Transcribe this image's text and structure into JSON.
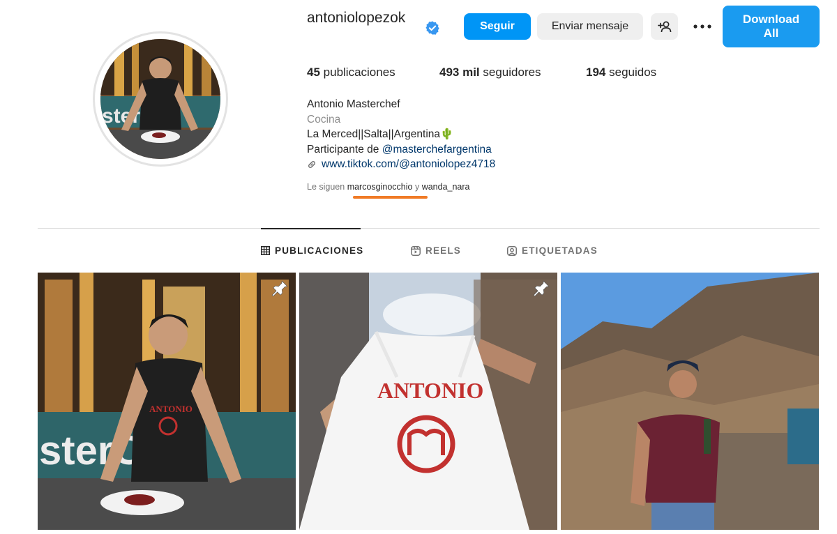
{
  "profile": {
    "username": "antoniolopezok",
    "verified": true,
    "display_name": "Antonio Masterchef",
    "category": "Cocina",
    "bio_line1": "La Merced||Salta||Argentina🌵",
    "bio_line2_prefix": "Participante de ",
    "bio_line2_mention": "@masterchefargentina",
    "link": "www.tiktok.com/@antoniolopez4718"
  },
  "actions": {
    "follow": "Seguir",
    "message": "Enviar mensaje",
    "add_user_icon": "add-user-icon",
    "more_icon": "more-options-icon",
    "download": "Download All"
  },
  "stats": {
    "posts_count": "45",
    "posts_label": "publicaciones",
    "followers_count": "493 mil",
    "followers_label": "seguidores",
    "following_count": "194",
    "following_label": "seguidos"
  },
  "followed_by": {
    "prefix": "Le siguen ",
    "account1": "marcosginocchio",
    "conjunction": " y ",
    "account2": "wanda_nara"
  },
  "tabs": [
    {
      "label": "PUBLICACIONES",
      "icon": "grid-icon",
      "active": true
    },
    {
      "label": "REELS",
      "icon": "reels-icon",
      "active": false
    },
    {
      "label": "ETIQUETADAS",
      "icon": "tagged-icon",
      "active": false
    }
  ],
  "posts": [
    {
      "pinned": true,
      "text": "ANTONIO"
    },
    {
      "pinned": true,
      "text": "ANTONIO"
    },
    {
      "pinned": false
    }
  ],
  "colors": {
    "primary_blue": "#0095f6",
    "verified_blue": "#3897f0",
    "highlight_underline": "#f07b26"
  }
}
